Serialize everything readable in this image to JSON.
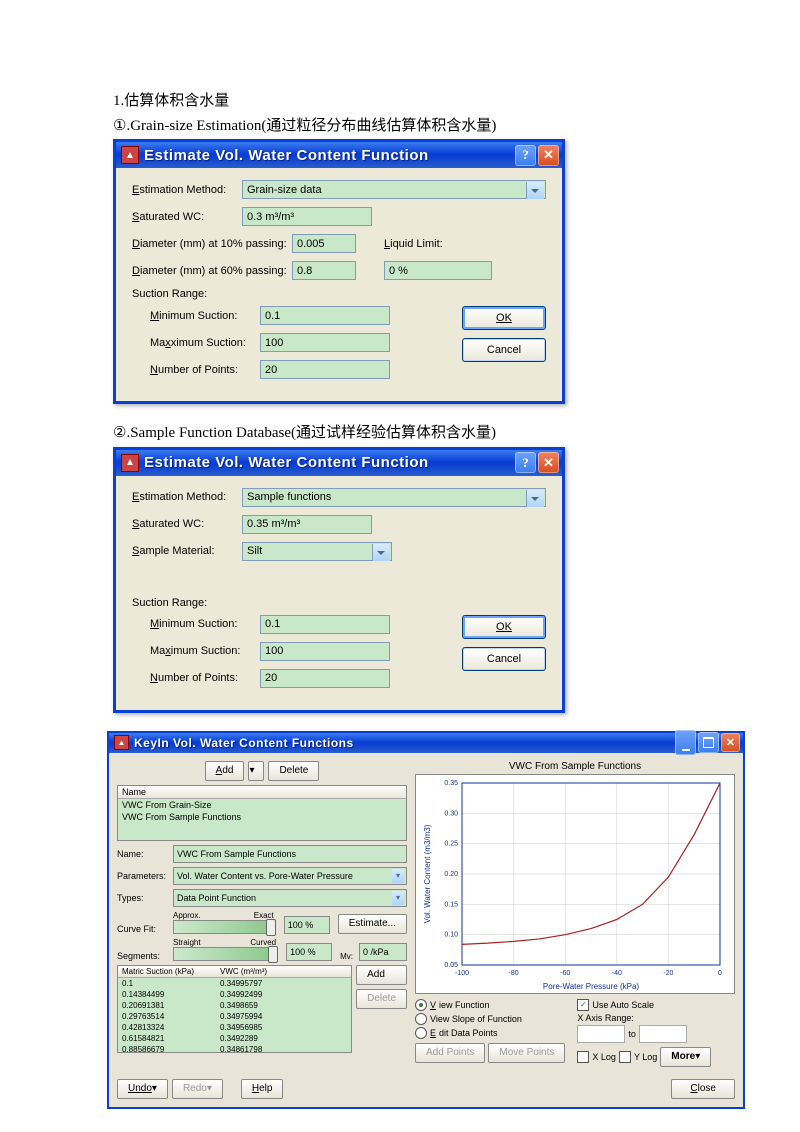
{
  "doc": {
    "line1": "1.估算体积含水量",
    "line2": "①.Grain-size Estimation(通过粒径分布曲线估算体积含水量)",
    "line3": "②.Sample Function Database(通过试样经验估算体积含水量)"
  },
  "d1": {
    "title": "Estimate Vol. Water Content Function",
    "lbl_method": "stimation Method:",
    "method": "Grain-size data",
    "lbl_sat": "aturated WC:",
    "sat": "0.3 m³/m³",
    "lbl_d10": "iameter (mm) at 10% passing:",
    "d10": "0.005",
    "lbl_ll_pre": "L",
    "lbl_ll": "iquid Limit:",
    "lbl_d60": "iameter (mm) at 60% passing:",
    "d60": "0.8",
    "ll": "0 %",
    "range_lbl": "Suction Range:",
    "lbl_min": "inimum Suction:",
    "min": "0.1",
    "lbl_max": "ximum Suction:",
    "max": "100",
    "lbl_pts": "umber of Points:",
    "pts": "20",
    "ok": "OK",
    "cancel": "Cancel"
  },
  "d2": {
    "title": "Estimate Vol. Water Content Function",
    "lbl_method": "stimation Method:",
    "method": "Sample functions",
    "lbl_sat": "aturated WC:",
    "sat": "0.35 m³/m³",
    "lbl_mat": "ample Material:",
    "mat": "Silt",
    "range_lbl": "Suction Range:",
    "lbl_min": "inimum Suction:",
    "min": "0.1",
    "lbl_max_pre": "Ma",
    "lbl_max": "imum Suction:",
    "max": "100",
    "lbl_pts": "umber of Points:",
    "pts": "20",
    "ok": "OK",
    "cancel": "Cancel"
  },
  "k": {
    "title": "KeyIn Vol. Water Content Functions",
    "add": "Add",
    "delete": "Delete",
    "list_hdr": "Name",
    "li1": "VWC From Grain-Size",
    "li2": "VWC From Sample Functions",
    "name_lbl": "Name:",
    "name": "VWC From Sample Functions",
    "params_lbl": "Parameters:",
    "params": "Vol. Water Content vs. Pore-Water Pressure",
    "types_lbl": "Types:",
    "types": "Data Point Function",
    "curve_lbl": "Curve Fit:",
    "approx": "Approx.",
    "exact": "Exact",
    "cf_val": "100 %",
    "estimate": "Estimate...",
    "seg_lbl": "Segments:",
    "straight": "Straight",
    "curved": "Curved",
    "seg_val": "100 %",
    "mv_lbl": "Mv:",
    "mv": "0 /kPa",
    "tbl_h1": "Matric Suction (kPa)",
    "tbl_h2": "VWC (m³/m³)",
    "rows": [
      [
        "0.1",
        "0.34995797"
      ],
      [
        "0.14384499",
        "0.34992499"
      ],
      [
        "0.20691381",
        "0.3498659"
      ],
      [
        "0.29763514",
        "0.34975994"
      ],
      [
        "0.42813324",
        "0.34956985"
      ],
      [
        "0.61584821",
        "0.3492289"
      ],
      [
        "0.88586679",
        "0.34861798"
      ]
    ],
    "addp": "Add",
    "del": "Delete",
    "chart_title": "VWC From Sample Functions",
    "view_func": "iew Function",
    "view_slope": "View Slope of Function",
    "edit_pts": "dit Data Points",
    "auto_scale": "Use Auto Scale",
    "xrange": "X Axis Range:",
    "to": "to",
    "addpts": "Add Points",
    "movepts": "Move Points",
    "xlog": "X Log",
    "ylog": "Y Log",
    "more": "More",
    "undo": "Undo",
    "redo": "Redo",
    "help": "Help",
    "close": "Close"
  },
  "chart_data": {
    "type": "line",
    "title": "VWC From Sample Functions",
    "xlabel": "Pore-Water Pressure (kPa)",
    "ylabel": "Vol. Water Content (m3/m3)",
    "xlim": [
      -100,
      0
    ],
    "ylim": [
      0.05,
      0.35
    ],
    "xticks": [
      -100,
      -80,
      -60,
      -40,
      -20,
      0
    ],
    "yticks": [
      0.05,
      0.1,
      0.15,
      0.2,
      0.25,
      0.3,
      0.35
    ],
    "x": [
      -100,
      -90,
      -80,
      -70,
      -60,
      -50,
      -40,
      -30,
      -20,
      -10,
      0
    ],
    "y": [
      0.084,
      0.086,
      0.089,
      0.093,
      0.1,
      0.11,
      0.125,
      0.15,
      0.195,
      0.265,
      0.35
    ]
  }
}
